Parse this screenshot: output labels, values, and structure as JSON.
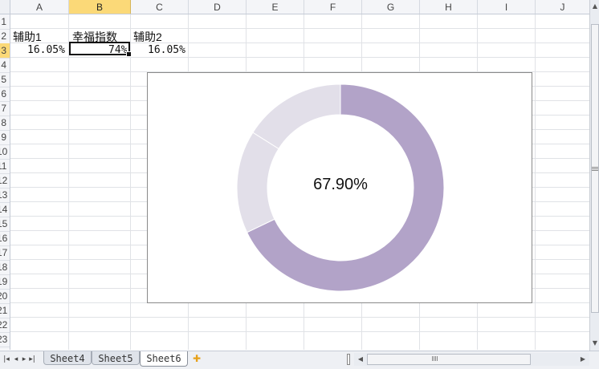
{
  "sheet": {
    "columns": [
      "A",
      "B",
      "C",
      "D",
      "E",
      "F",
      "G",
      "H",
      "I",
      "J"
    ],
    "selected_column": "B",
    "rows": [
      "1",
      "2",
      "3",
      "4",
      "5",
      "6",
      "7",
      "8",
      "9",
      "10",
      "11",
      "12",
      "13",
      "14",
      "15",
      "16",
      "17",
      "18",
      "19",
      "20",
      "21",
      "22",
      "23"
    ],
    "selected_row": "3",
    "cells": {
      "A2": "辅助1",
      "B2": "幸福指数",
      "C2": "辅助2",
      "A3": "16.05%",
      "B3": "74%",
      "C3": "16.05%"
    }
  },
  "chart_data": {
    "type": "pie",
    "variant": "donut",
    "center_label": "67.90%",
    "slices": [
      {
        "label": "辅助1",
        "value": 16.05,
        "color": "#e2dfe9"
      },
      {
        "label": "幸福指数",
        "value": 67.9,
        "color": "#b2a3c8"
      },
      {
        "label": "辅助2",
        "value": 16.05,
        "color": "#e2dfe9"
      }
    ],
    "legend": "none"
  },
  "tabs": {
    "items": [
      "Sheet4",
      "Sheet5",
      "Sheet6"
    ],
    "active": "Sheet6",
    "new_sheet_icon": "insert-sheet-icon"
  },
  "colors": {
    "selection_header": "#fbd978",
    "grid": "#e0e2e6",
    "chart_border": "#8a8a8a"
  }
}
